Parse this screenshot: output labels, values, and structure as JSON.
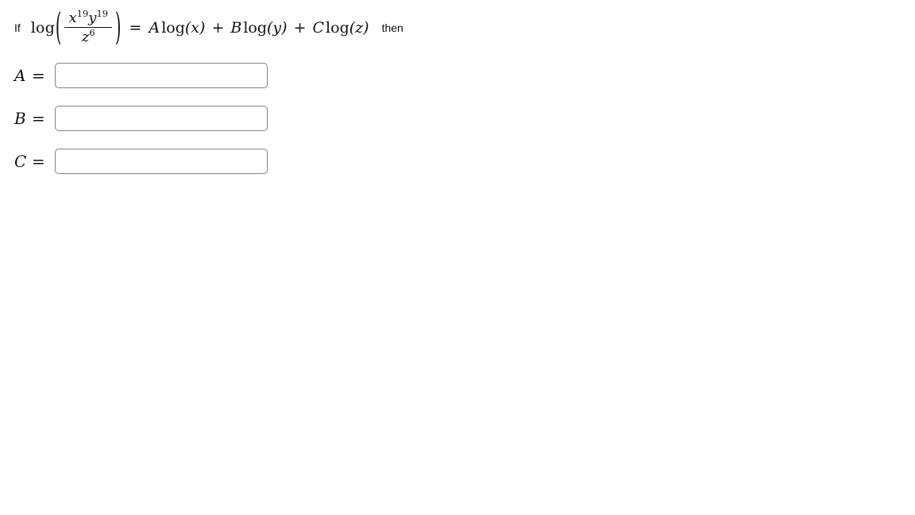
{
  "problem": {
    "lead_word": "If",
    "log_name": "log",
    "open_paren": "(",
    "close_paren": ")",
    "numerator": {
      "base1": "x",
      "exponent1": "19",
      "base2": "y",
      "exponent2": "19"
    },
    "denominator": {
      "base": "z",
      "exponent": "6"
    },
    "equals": "=",
    "terms": [
      {
        "coefficient": "A",
        "function": "log",
        "argument": "(x)"
      },
      {
        "coefficient": "B",
        "function": "log",
        "argument": "(y)"
      },
      {
        "coefficient": "C",
        "function": "log",
        "argument": "(z)"
      }
    ],
    "plus": "+",
    "trailing_word": "then"
  },
  "answers": [
    {
      "variable": "A",
      "equals": "=",
      "value": "",
      "placeholder": ""
    },
    {
      "variable": "B",
      "equals": "=",
      "value": "",
      "placeholder": ""
    },
    {
      "variable": "C",
      "equals": "=",
      "value": "",
      "placeholder": ""
    }
  ],
  "colors": {
    "background": "#ffffff",
    "text": "#111111",
    "input_border": "#848484"
  }
}
